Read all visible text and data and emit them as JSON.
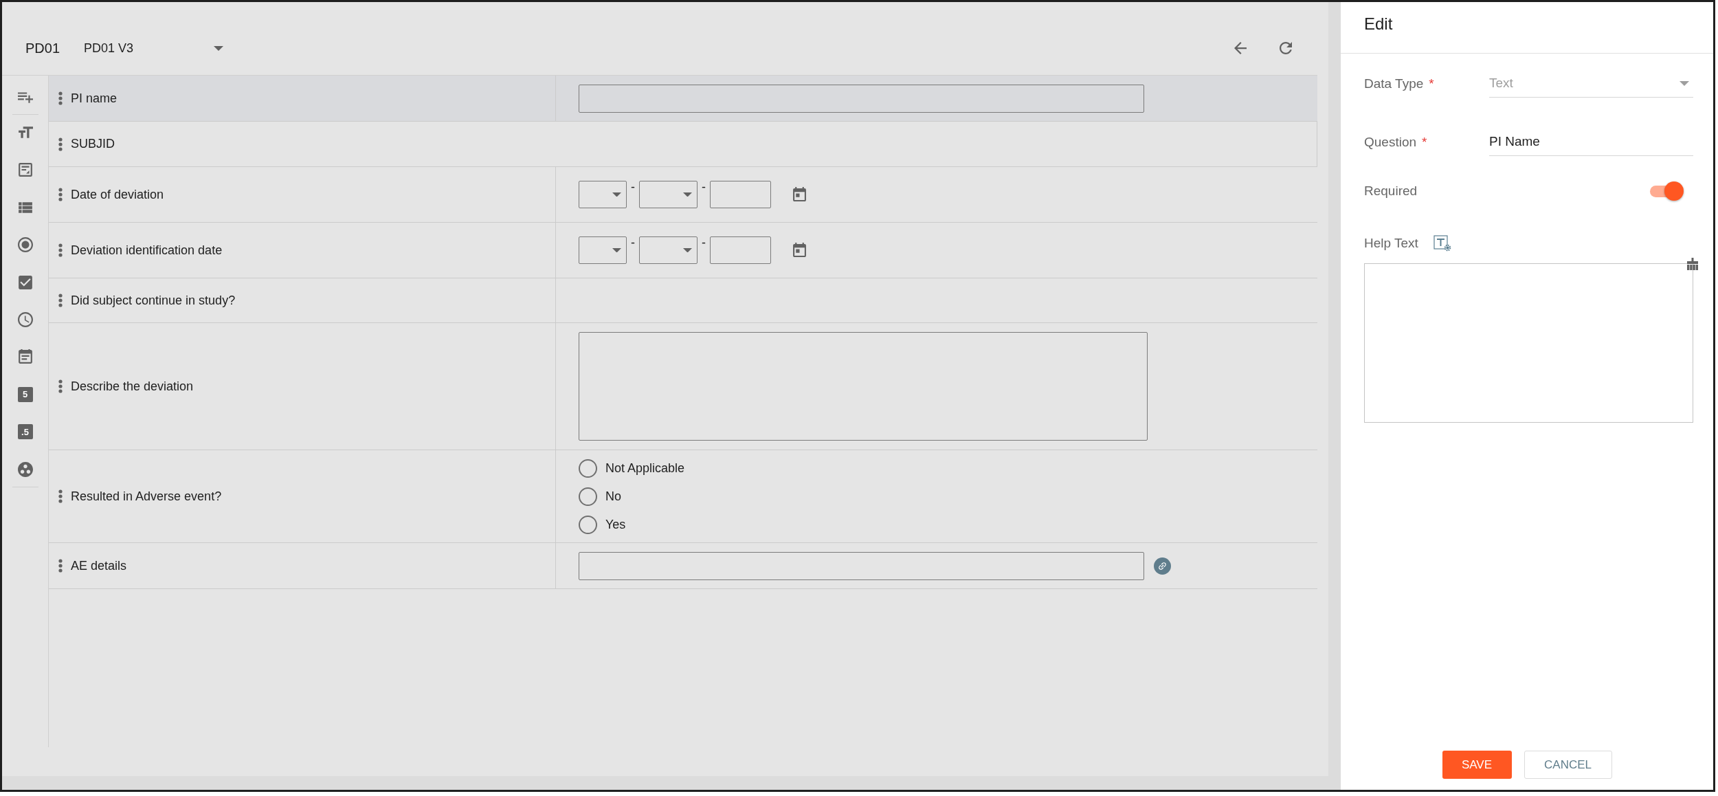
{
  "header": {
    "form_code": "PD01",
    "version_select": {
      "value": "PD01 V3"
    }
  },
  "toolbar": {
    "tools": [
      {
        "kind": "add"
      },
      {
        "kind": "text"
      },
      {
        "kind": "textarea"
      },
      {
        "kind": "list"
      },
      {
        "kind": "radio"
      },
      {
        "kind": "checkbox"
      },
      {
        "kind": "time"
      },
      {
        "kind": "date"
      },
      {
        "kind": "number",
        "glyph": "5"
      },
      {
        "kind": "number",
        "glyph": ".5"
      },
      {
        "kind": "group"
      }
    ]
  },
  "form": {
    "rows": [
      {
        "label": "PI name",
        "kind": "text",
        "selected": true,
        "linked": false
      },
      {
        "label": "SUBJID",
        "kind": "section",
        "selected": false
      },
      {
        "label": "Date of deviation",
        "kind": "date",
        "selected": false,
        "separators": [
          "-",
          "-"
        ]
      },
      {
        "label": "Deviation identification date",
        "kind": "date",
        "selected": false,
        "separators": [
          "-",
          "-"
        ]
      },
      {
        "label": "Did subject continue in study?",
        "kind": "blank",
        "selected": false
      },
      {
        "label": "Describe the deviation",
        "kind": "textarea",
        "selected": false
      },
      {
        "label": "Resulted in Adverse event?",
        "kind": "radio",
        "selected": false,
        "options": [
          {
            "label": "Not Applicable",
            "selected": false
          },
          {
            "label": "No",
            "selected": false
          },
          {
            "label": "Yes",
            "selected": false
          }
        ]
      },
      {
        "label": "AE details",
        "kind": "text",
        "selected": false,
        "linked": true
      }
    ]
  },
  "edit_panel": {
    "title": "Edit",
    "fields": [
      {
        "kind": "select",
        "label": "Data Type",
        "required_mark": "*",
        "value": "Text",
        "disabled": true
      },
      {
        "kind": "input",
        "label": "Question",
        "required_mark": "*",
        "value": "PI Name",
        "disabled": false
      },
      {
        "kind": "toggle",
        "label": "Required",
        "on": true
      },
      {
        "kind": "richtext",
        "label": "Help Text"
      }
    ],
    "buttons": [
      {
        "label": "SAVE",
        "kind": "primary"
      },
      {
        "label": "CANCEL",
        "kind": "secondary"
      }
    ]
  }
}
